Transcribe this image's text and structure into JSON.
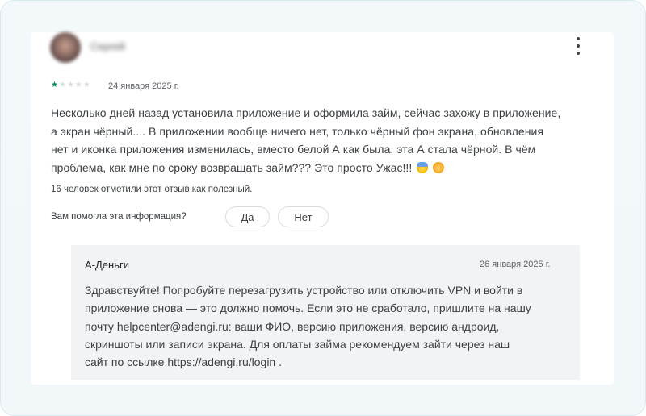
{
  "review": {
    "author_name": "Сергей",
    "rating": 1,
    "max_rating": 5,
    "date": "24 января 2025 г.",
    "text_lines": [
      "Несколько дней назад установила приложение и оформила займ, сейчас захожу в приложение,",
      "а экран чёрный.... В приложении вообще ничего нет, только чёрный фон экрана, обновления",
      "нет и иконка приложения изменилась, вместо белой А как была, эта А стала чёрной. В чём",
      "проблема, как мне по сроку возвращать займ??? Это просто Ужас!!!"
    ],
    "emojis": [
      "face-screaming-icon",
      "face-sweat-icon"
    ],
    "helpful_count_text": "16 человек отметили этот отзыв как полезный.",
    "helpful_question": "Вам помогла эта информация?",
    "yes_label": "Да",
    "no_label": "Нет"
  },
  "reply": {
    "author": "А-Деньги",
    "date": "26 января 2025 г.",
    "text_lines": [
      "Здравствуйте! Попробуйте перезагрузить устройство или отключить VPN и войти в",
      "приложение снова — это должно помочь. Если это не сработало, пришлите на нашу",
      "почту helpcenter@adengi.ru: ваши ФИО, версию приложения, версию андроид,",
      "скриншоты или записи экрана. Для оплаты займа рекомендуем зайти через наш",
      "сайт по ссылке https://adengi.ru/login ."
    ]
  },
  "colors": {
    "star_filled": "#01875f",
    "star_empty": "#dadce0",
    "reply_bg": "#f1f3f4"
  }
}
